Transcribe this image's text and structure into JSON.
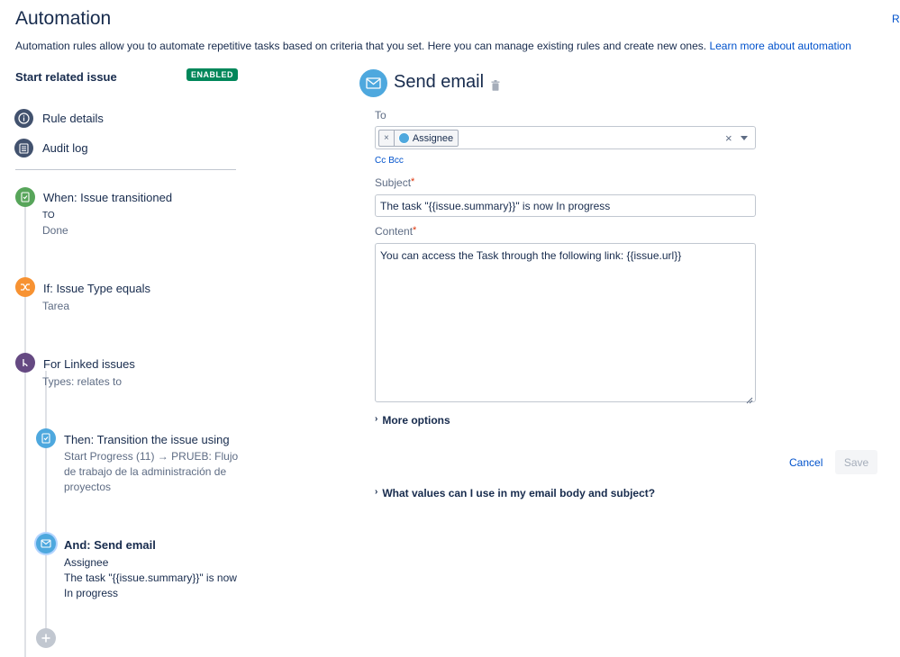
{
  "page": {
    "title": "Automation",
    "corner_letter": "R",
    "description": "Automation rules allow you to automate repetitive tasks based on criteria that you set. Here you can manage existing rules and create new ones.",
    "learn_more": "Learn more about automation"
  },
  "rule": {
    "name": "Start related issue",
    "status_badge": "ENABLED"
  },
  "sidebar": {
    "rule_details": "Rule details",
    "audit_log": "Audit log"
  },
  "steps": [
    {
      "title": "When: Issue transitioned",
      "label": "TO",
      "detail": "Done",
      "color": "#57a55a"
    },
    {
      "title": "If: Issue Type equals",
      "detail": "Tarea",
      "color": "#f79232"
    },
    {
      "title": "For Linked issues",
      "detail": "Types: relates to",
      "color": "#654982"
    },
    {
      "title": "Then: Transition the issue using",
      "detail_lines": [
        "Start Progress (11) → PRUEB: Flujo",
        "de trabajo de la administración de",
        "proyectos"
      ],
      "color": "#4ea8de"
    },
    {
      "title": "And: Send email",
      "detail_lines": [
        "Assignee",
        "The task \"{{issue.summary}}\" is now",
        "In progress"
      ],
      "color": "#4ea8de"
    }
  ],
  "editor": {
    "title": "Send email",
    "to_label": "To",
    "to_chip": "Assignee",
    "chip_remove": "×",
    "clear": "×",
    "cc": "Cc",
    "bcc": "Bcc",
    "subject_label": "Subject",
    "subject_value": "The task \"{{issue.summary}}\" is now In progress",
    "content_label": "Content",
    "content_value": "You can access the Task through the following link: {{issue.url}}",
    "required_mark": "*",
    "more_options": "More options",
    "values_help": "What values can I use in my email body and subject?",
    "cancel": "Cancel",
    "save": "Save"
  }
}
